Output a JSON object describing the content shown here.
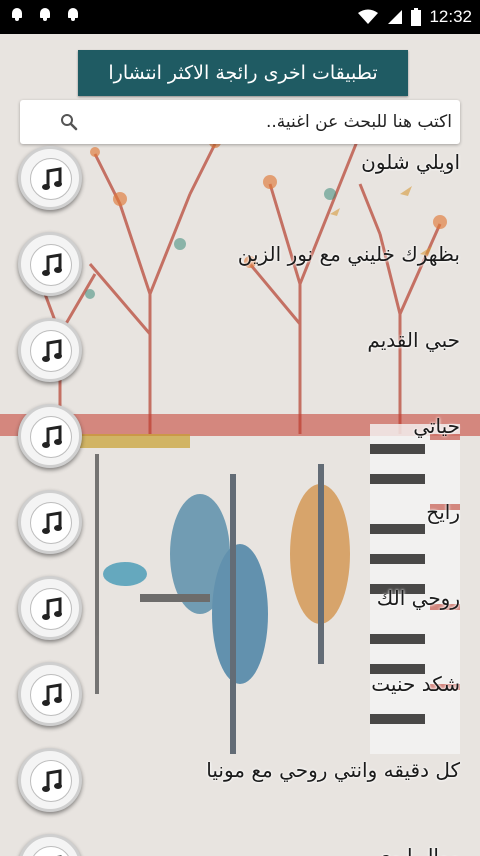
{
  "status_bar": {
    "time": "12:32",
    "notification_icons": [
      "bell-icon",
      "bell-icon",
      "bell-icon"
    ]
  },
  "promo": {
    "label": "تطبيقات اخرى رائجة الاكثر انتشارا"
  },
  "search": {
    "placeholder": "اكتب هنا للبحث عن اغنية.."
  },
  "songs": [
    {
      "title": "اويلي شلون"
    },
    {
      "title": "بظهرك خليني مع نور الزين"
    },
    {
      "title": "حبي القديم"
    },
    {
      "title": "حياتي"
    },
    {
      "title": "رايح"
    },
    {
      "title": "روحي الك"
    },
    {
      "title": "شكد حنيت"
    },
    {
      "title": "كل دقيقه وانتي روحي مع مونيا"
    },
    {
      "title": "موال ابوي"
    }
  ],
  "colors": {
    "promo_bg": "#1f5b63",
    "status_bar_bg": "#000000",
    "background": "#e9e6e2"
  }
}
